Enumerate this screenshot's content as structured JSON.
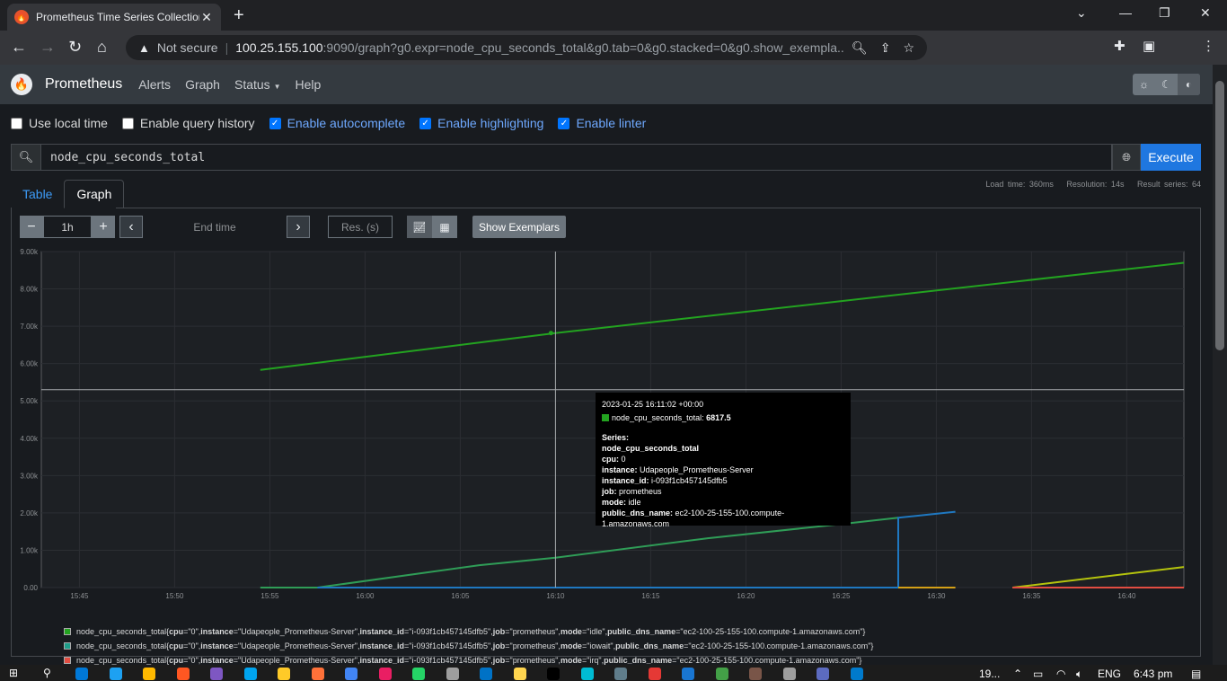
{
  "browser": {
    "tab_title": "Prometheus Time Series Collection",
    "tab_close": "✕",
    "new_tab": "+",
    "security_label": "Not secure",
    "url_host": "100.25.155.100",
    "url_rest": ":9090/graph?g0.expr=node_cpu_seconds_total&g0.tab=0&g0.stacked=0&g0.show_exempla...",
    "extension_colors": [
      "#4a8af4",
      "#e11c26",
      "#f9c513",
      "#7b58d6",
      "#2196f3",
      "#6c6c6c"
    ]
  },
  "nav": {
    "brand": "Prometheus",
    "links": [
      "Alerts",
      "Graph",
      "Status",
      "Help"
    ]
  },
  "options": {
    "use_local_time": "Use local time",
    "enable_query_history": "Enable query history",
    "enable_autocomplete": "Enable autocomplete",
    "enable_highlighting": "Enable highlighting",
    "enable_linter": "Enable linter"
  },
  "query": {
    "expression": "node_cpu_seconds_total",
    "execute_label": "Execute"
  },
  "stats": {
    "load_time": "Load time: 360ms",
    "resolution": "Resolution: 14s",
    "result_series": "Result series: 64"
  },
  "tabs": {
    "table": "Table",
    "graph": "Graph"
  },
  "controls": {
    "minus": "−",
    "range": "1h",
    "plus": "+",
    "prev": "‹",
    "end_time_placeholder": "End time",
    "next": "›",
    "res_placeholder": "Res. (s)",
    "show_exemplars": "Show Exemplars"
  },
  "chart_data": {
    "type": "line",
    "x_ticks": [
      "15:45",
      "15:50",
      "15:55",
      "16:00",
      "16:05",
      "16:10",
      "16:15",
      "16:20",
      "16:25",
      "16:30",
      "16:35",
      "16:40"
    ],
    "y_ticks": [
      "0.00",
      "1.00k",
      "2.00k",
      "3.00k",
      "4.00k",
      "5.00k",
      "6.00k",
      "7.00k",
      "8.00k",
      "9.00k"
    ],
    "ylim": [
      0,
      9000
    ],
    "xlim_minutes": [
      -27,
      33
    ],
    "grid": true,
    "series": [
      {
        "color": "#23a320",
        "points": [
          [
            -15.5,
            5830
          ],
          [
            0,
            6817.5
          ],
          [
            33,
            8700
          ]
        ]
      },
      {
        "color": "#2f9d57",
        "points": [
          [
            -15.5,
            0
          ],
          [
            -12.5,
            0
          ],
          [
            -4,
            600
          ],
          [
            0,
            800
          ],
          [
            8,
            1320
          ],
          [
            15,
            1700
          ],
          [
            18,
            1870
          ]
        ]
      },
      {
        "color": "#1f78c1",
        "points": [
          [
            -12.5,
            0
          ],
          [
            18,
            0
          ],
          [
            18,
            1870
          ],
          [
            21,
            2030
          ]
        ]
      },
      {
        "color": "#b5c40d",
        "points": [
          [
            24,
            0
          ],
          [
            33,
            550
          ]
        ]
      },
      {
        "color": "#e24d42",
        "points": [
          [
            24,
            0
          ],
          [
            33,
            0
          ]
        ]
      },
      {
        "color": "#d4a017",
        "points": [
          [
            18,
            0
          ],
          [
            21,
            0
          ]
        ]
      }
    ],
    "crosshair_minutes": 0,
    "crosshair_value": 5300
  },
  "tooltip": {
    "date": "2023-01-25 16:11:02 +00:00",
    "metric": "node_cpu_seconds_total:",
    "value": "6817.5",
    "series_label": "Series:",
    "name": "node_cpu_seconds_total",
    "labels": [
      {
        "key": "cpu:",
        "value": "0"
      },
      {
        "key": "instance:",
        "value": "Udapeople_Prometheus-Server"
      },
      {
        "key": "instance_id:",
        "value": "i-093f1cb457145dfb5"
      },
      {
        "key": "job:",
        "value": "prometheus"
      },
      {
        "key": "mode:",
        "value": "idle"
      },
      {
        "key": "public_dns_name:",
        "value": "ec2-100-25-155-100.compute-1.amazonaws.com"
      }
    ]
  },
  "legend": [
    {
      "color": "#23a320",
      "prefix": "node_cpu_seconds_total{",
      "cpu": "cpu=\"0\"",
      "instance": "instance=\"Udapeople_Prometheus-Server\"",
      "instance_id": "instance_id=\"i-093f1cb457145dfb5\"",
      "job": "job=\"prometheus\"",
      "mode": "mode=\"idle\"",
      "dns": "public_dns_name=\"ec2-100-25-155-100.compute-1.amazonaws.com\"}"
    },
    {
      "color": "#1f9e8a",
      "prefix": "node_cpu_seconds_total{",
      "cpu": "cpu=\"0\"",
      "instance": "instance=\"Udapeople_Prometheus-Server\"",
      "instance_id": "instance_id=\"i-093f1cb457145dfb5\"",
      "job": "job=\"prometheus\"",
      "mode": "mode=\"iowait\"",
      "dns": "public_dns_name=\"ec2-100-25-155-100.compute-1.amazonaws.com\"}"
    },
    {
      "color": "#e24d42",
      "prefix": "node_cpu_seconds_total{",
      "cpu": "cpu=\"0\"",
      "instance": "instance=\"Udapeople_Prometheus-Server\"",
      "instance_id": "instance_id=\"i-093f1cb457145dfb5\"",
      "job": "job=\"prometheus\"",
      "mode": "mode=\"irq\"",
      "dns": "public_dns_name=\"ec2-100-25-155-100.compute-1.amazonaws.com\"}"
    }
  ],
  "taskbar": {
    "weather": "19...",
    "lang": "ENG",
    "time": "6:43 pm",
    "app_colors": [
      "#0078d7",
      "#1da1f2",
      "#ffb900",
      "#ff5722",
      "#7e57c2",
      "#00a4ef",
      "#ffca28",
      "#ff7139",
      "#4285f4",
      "#e91e63",
      "#25d366",
      "#9e9e9e",
      "#0072c6",
      "#ffd54f",
      "#000000",
      "#00bcd4",
      "#607d8b",
      "#e53935",
      "#1976d2",
      "#43a047",
      "#795548",
      "#9e9e9e",
      "#5c6bc0",
      "#007acc"
    ]
  }
}
